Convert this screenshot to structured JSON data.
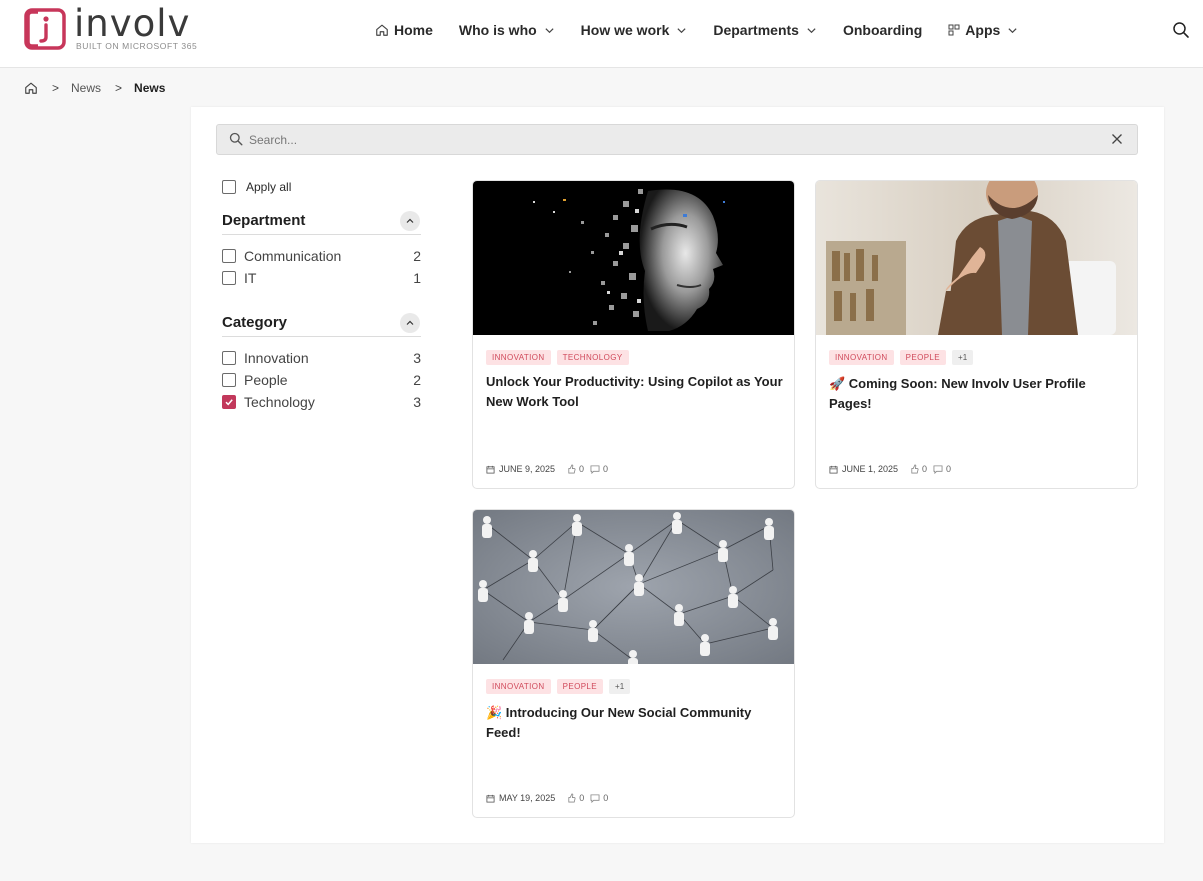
{
  "header": {
    "logo_word": "involv",
    "logo_sub": "BUILT ON MICROSOFT 365",
    "nav": [
      {
        "label": "Home",
        "icon": "home-icon"
      },
      {
        "label": "Who is who",
        "icon": "chevron-down-icon"
      },
      {
        "label": "How we work",
        "icon": "chevron-down-icon"
      },
      {
        "label": "Departments",
        "icon": "chevron-down-icon"
      },
      {
        "label": "Onboarding"
      },
      {
        "label": "Apps",
        "icon": "apps-icon"
      }
    ],
    "search_icon": "search-icon"
  },
  "breadcrumb": {
    "home_icon": "home-icon",
    "items": [
      "News",
      "News"
    ],
    "separator": ">"
  },
  "search": {
    "placeholder": "Search...",
    "value": ""
  },
  "filters": {
    "apply_all": "Apply all",
    "groups": [
      {
        "title": "Department",
        "options": [
          {
            "label": "Communication",
            "count": "2",
            "checked": false
          },
          {
            "label": "IT",
            "count": "1",
            "checked": false
          }
        ]
      },
      {
        "title": "Category",
        "options": [
          {
            "label": "Innovation",
            "count": "3",
            "checked": false
          },
          {
            "label": "People",
            "count": "2",
            "checked": false
          },
          {
            "label": "Technology",
            "count": "3",
            "checked": true
          }
        ]
      }
    ]
  },
  "articles": [
    {
      "tags": [
        "INNOVATION",
        "TECHNOLOGY"
      ],
      "more": "",
      "title": "Unlock Your Productivity: Using Copilot as Your New Work Tool",
      "date": "JUNE 9, 2025",
      "likes": "0",
      "comments": "0",
      "image": "digital-face"
    },
    {
      "tags": [
        "INNOVATION",
        "PEOPLE"
      ],
      "more": "+1",
      "title": "🚀 Coming Soon: New Involv User Profile Pages!",
      "date": "JUNE 1, 2025",
      "likes": "0",
      "comments": "0",
      "image": "handshake-man"
    },
    {
      "tags": [
        "INNOVATION",
        "PEOPLE"
      ],
      "more": "+1",
      "title": "🎉 Introducing Our New Social Community Feed!",
      "date": "MAY 19, 2025",
      "likes": "0",
      "comments": "0",
      "image": "network-figures"
    }
  ],
  "colors": {
    "accent": "#c2385b",
    "tag_bg": "#fde2e4",
    "tag_text": "#d04a5b"
  }
}
